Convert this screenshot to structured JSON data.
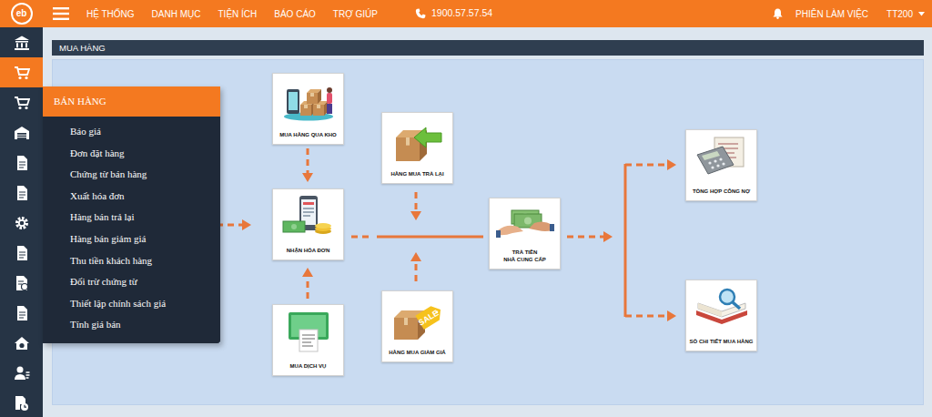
{
  "topbar": {
    "logo": "eb",
    "menus": [
      "HỆ THỐNG",
      "DANH MỤC",
      "TIỆN ÍCH",
      "BÁO CÁO",
      "TRỢ GIÚP"
    ],
    "hotline": "1900.57.57.54",
    "session": "PHIÊN LÀM VIỆC",
    "user": "TT200"
  },
  "sidebar": {
    "items": [
      {
        "selected": false,
        "expanded": false
      },
      {
        "selected": true,
        "expanded": false
      },
      {
        "selected": false,
        "expanded": true,
        "title": "BÁN HÀNG",
        "children": [
          "Báo giá",
          "Đơn đặt hàng",
          "Chứng từ bán hàng",
          "Xuất hóa đơn",
          "Hàng bán trả lại",
          "Hàng bán giảm giá",
          "Thu tiền khách hàng",
          "Đối trừ chứng từ",
          "Thiết lập chính sách giá",
          "Tính giá bán"
        ]
      },
      {
        "selected": false,
        "expanded": false
      },
      {
        "selected": false,
        "expanded": false
      },
      {
        "selected": false,
        "expanded": false
      },
      {
        "selected": false,
        "expanded": false
      },
      {
        "selected": false,
        "expanded": false
      },
      {
        "selected": false,
        "expanded": false
      },
      {
        "selected": false,
        "expanded": false
      },
      {
        "selected": false,
        "expanded": false
      },
      {
        "selected": false,
        "expanded": false
      },
      {
        "selected": false,
        "expanded": false
      }
    ]
  },
  "page": {
    "title": "MUA HÀNG"
  },
  "diagram": {
    "nodes": [
      {
        "lines": [
          "MUA HÀNG QUA KHO"
        ]
      },
      {
        "lines": [
          "NHẬN HÓA ĐƠN"
        ]
      },
      {
        "lines": [
          "MUA DỊCH VỤ"
        ]
      },
      {
        "lines": [
          "HÀNG MUA TRẢ LẠI"
        ]
      },
      {
        "lines": [
          "HÀNG MUA GIẢM GIÁ"
        ],
        "badge": "SALE"
      },
      {
        "lines": [
          "TRẢ TIỀN",
          "NHÀ CUNG CẤP"
        ]
      },
      {
        "lines": [
          "TỔNG HỢP CÔNG NỢ"
        ]
      },
      {
        "lines": [
          "SỔ CHI TIẾT MUA HÀNG"
        ]
      }
    ]
  }
}
